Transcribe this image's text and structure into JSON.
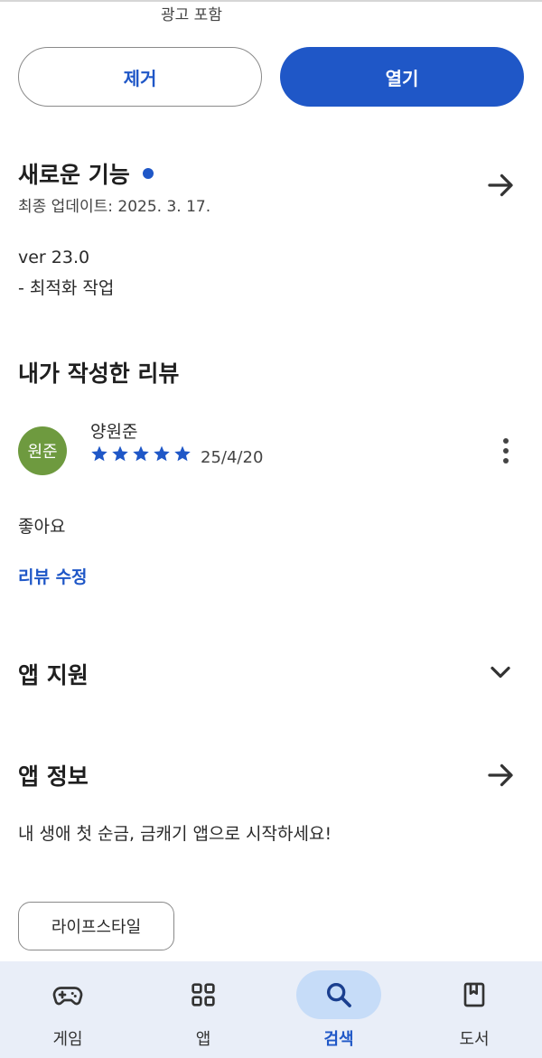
{
  "header": {
    "ads_note": "광고 포함"
  },
  "actions": {
    "remove_label": "제거",
    "open_label": "열기"
  },
  "whats_new": {
    "title": "새로운 기능",
    "updated": "최종 업데이트: 2025. 3. 17.",
    "notes": [
      "ver 23.0",
      "- 최적화 작업"
    ],
    "arrow_icon": "arrow-right-icon"
  },
  "my_review": {
    "title": "내가 작성한 리뷰",
    "avatar_text": "원준",
    "avatar_color": "#6e9a3f",
    "reviewer": "양원준",
    "rating": 5,
    "date": "25/4/20",
    "text": "좋아요",
    "edit_label": "리뷰 수정"
  },
  "app_support": {
    "title": "앱 지원",
    "icon": "chevron-down-icon"
  },
  "app_info": {
    "title": "앱 정보",
    "description": "내 생애 첫 순금, 금캐기 앱으로 시작하세요!",
    "category_chip": "라이프스타일"
  },
  "bottom_nav": {
    "items": [
      {
        "label": "게임",
        "icon": "gamepad-icon",
        "active": false
      },
      {
        "label": "앱",
        "icon": "apps-grid-icon",
        "active": false
      },
      {
        "label": "검색",
        "icon": "search-icon",
        "active": true
      },
      {
        "label": "도서",
        "icon": "book-icon",
        "active": false
      }
    ]
  },
  "colors": {
    "accent": "#1f57c7",
    "nav_bg": "#e9eef8",
    "nav_active_bg": "#c6dcf8"
  }
}
